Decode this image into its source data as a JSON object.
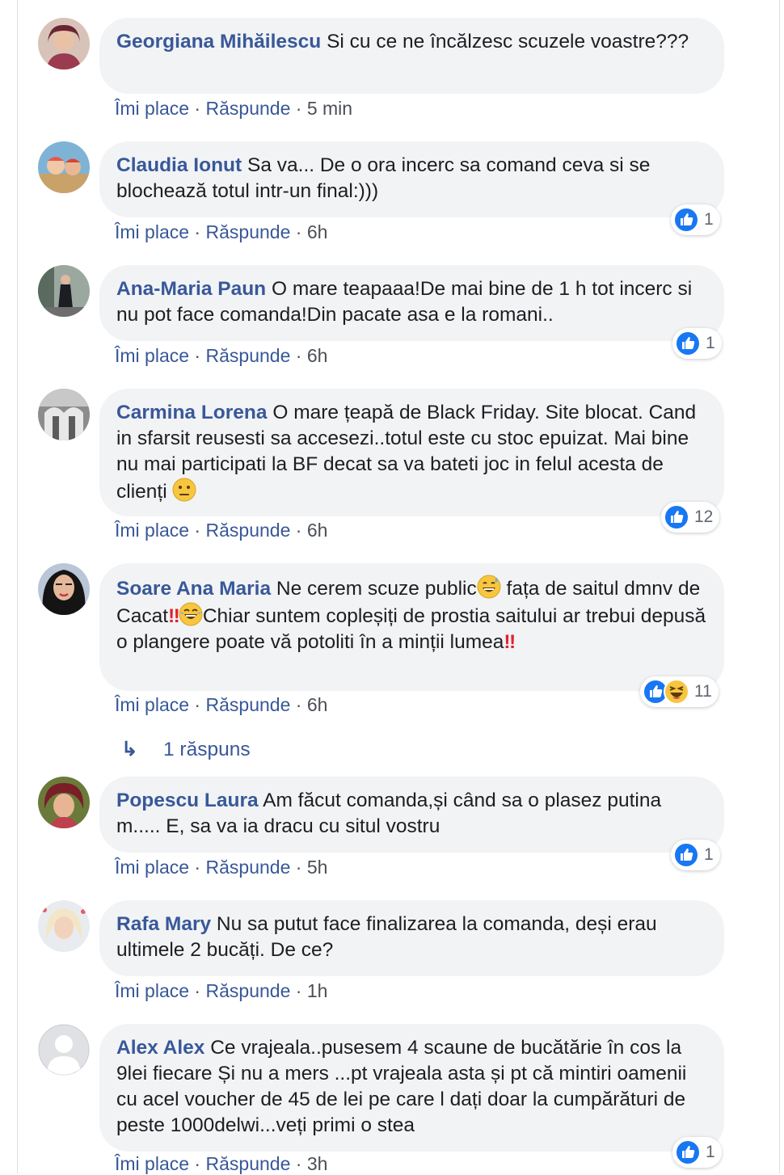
{
  "actions": {
    "like": "Îmi place",
    "reply": "Răspunde",
    "sep": " · "
  },
  "colors": {
    "author": "#385898",
    "bubble": "#f2f3f5",
    "like_blue": "#1877f2"
  },
  "comments": [
    {
      "author": "Georgiana Mihăilescu",
      "text": "Si cu ce ne încălzesc scuzele voastre???",
      "time": "5 min",
      "reaction_count": ""
    },
    {
      "author": "Claudia Ionut",
      "text": "Sa va... De o ora incerc sa comand ceva si se blochează totul intr-un final:)))",
      "time": "6h",
      "reaction_count": "1"
    },
    {
      "author": "Ana-Maria Paun",
      "text": "O mare teapaaa!De mai bine de 1 h tot incerc si nu pot face comanda!Din pacate asa e la romani..",
      "time": "6h",
      "reaction_count": "1"
    },
    {
      "author": "Carmina Lorena",
      "text": "O mare țeapă de Black Friday. Site blocat. Cand in sfarsit reusesti sa accesezi..totul este cu stoc epuizat. Mai bine nu mai participati la BF decat sa va bateti joc in felul acesta de clienți",
      "time": "6h",
      "reaction_count": "12"
    },
    {
      "author": "Soare Ana Maria",
      "text_parts": [
        "Ne cerem scuze public",
        " fața de saitul dmnv de Cacat",
        "Chiar suntem copleșiți de prostia saitului ar trebui depusă o plangere poate vă potoliti în a minții lumea"
      ],
      "time": "6h",
      "reaction_count": "11"
    },
    {
      "author": "Popescu Laura",
      "text": "Am făcut comanda,și când sa o plasez putina m..... E, sa va ia dracu cu situl vostru",
      "time": "5h",
      "reaction_count": "1"
    },
    {
      "author": "Rafa Mary",
      "text": "Nu sa putut face finalizarea la comanda, deși erau ultimele 2 bucăți. De ce?",
      "time": "1h",
      "reaction_count": ""
    },
    {
      "author": "Alex Alex",
      "text": "Ce vrajeala..pusesem 4 scaune de bucătărie în cos la 9lei fiecare Și nu a mers ...pt vrajeala asta și pt că mintiri oamenii cu acel voucher de 45 de lei pe care l dați doar la cumpărături de peste 1000delwi...veți primi o stea",
      "time": "3h",
      "reaction_count": "1"
    }
  ],
  "replies_link": {
    "arrow": "↳",
    "label": "1 răspuns"
  },
  "emojis": {
    "bang": "‼"
  }
}
